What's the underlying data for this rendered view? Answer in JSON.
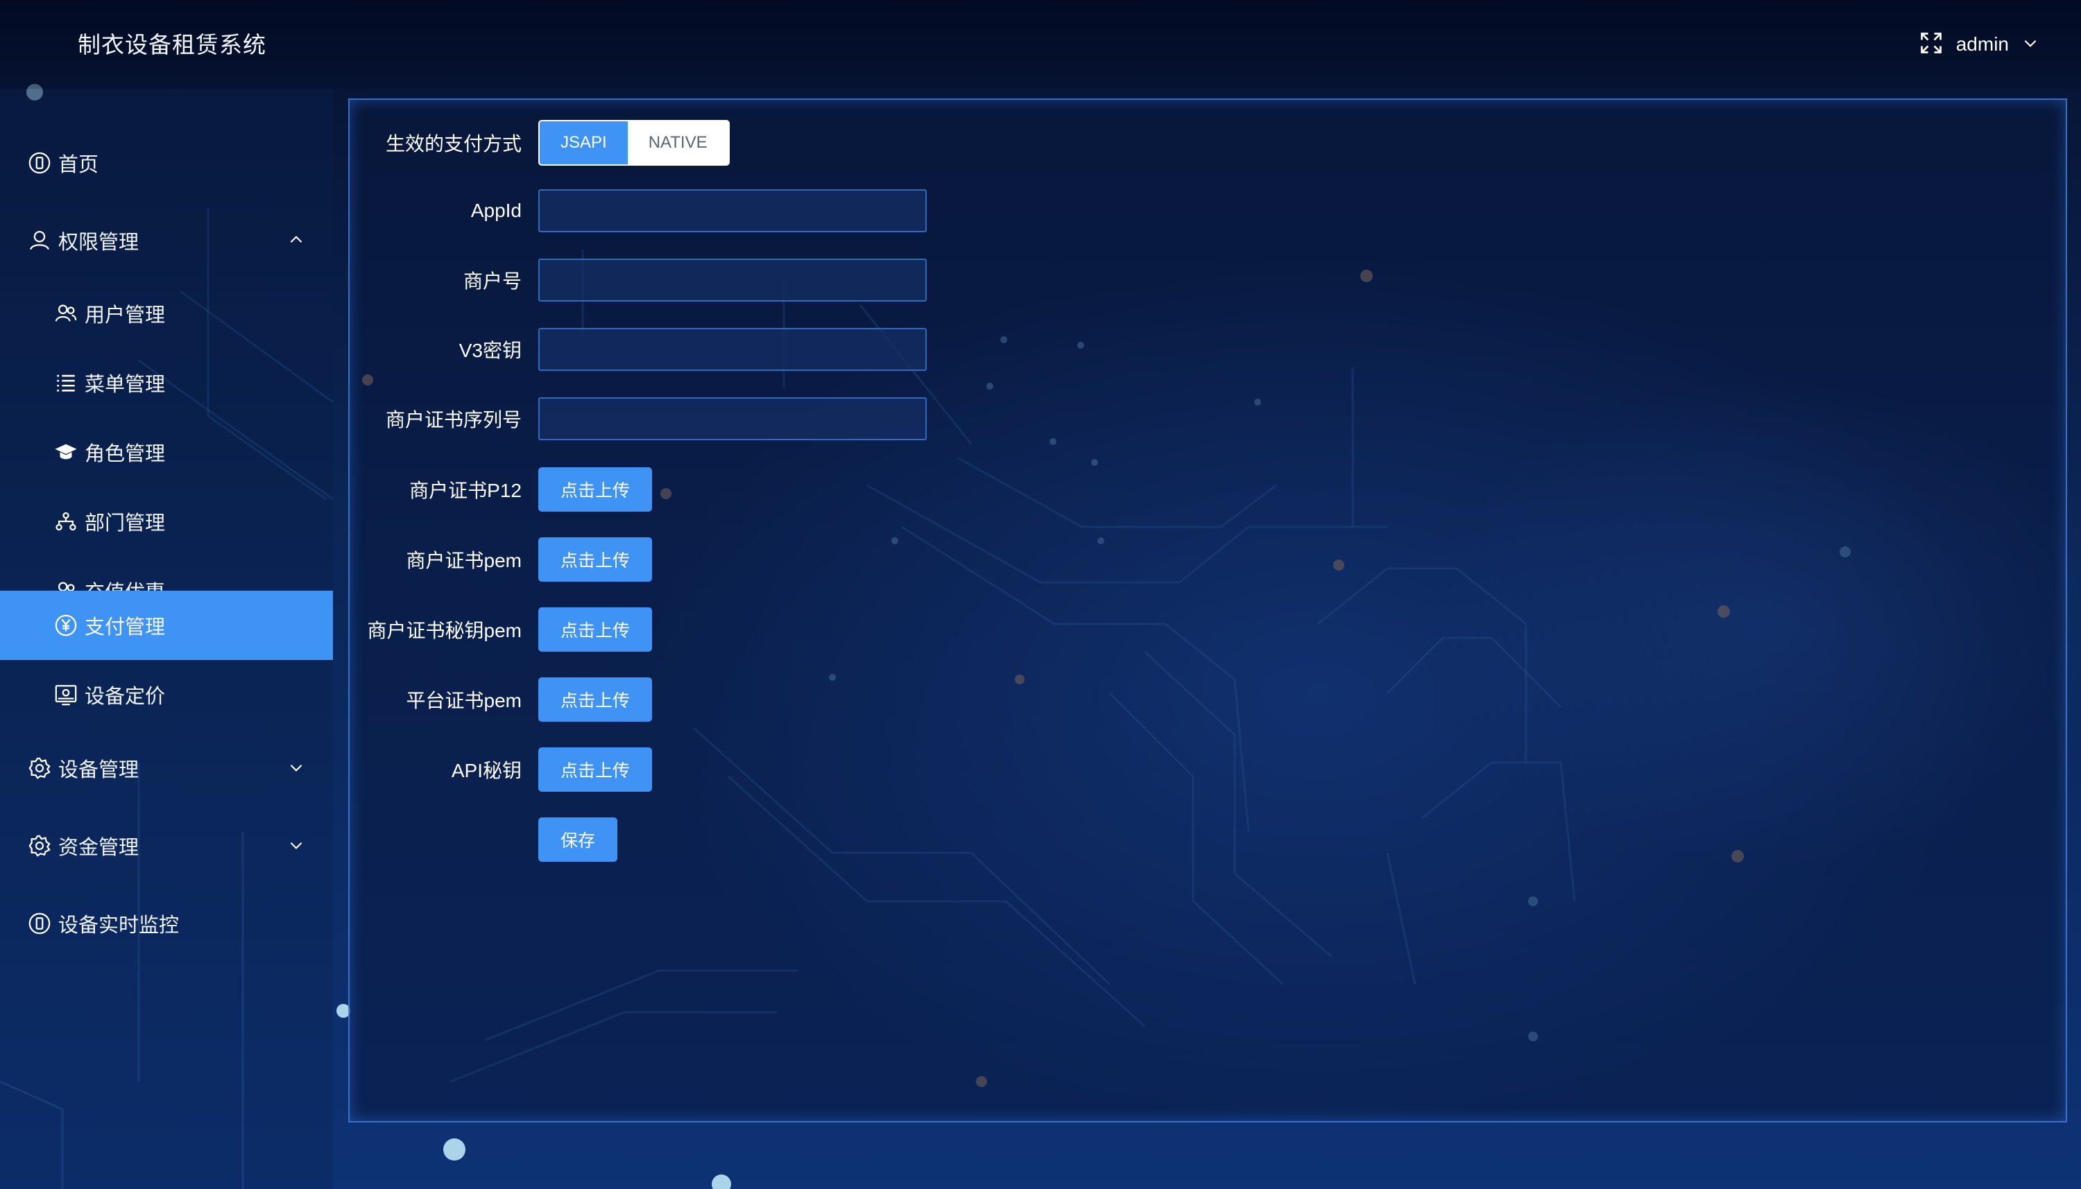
{
  "app": {
    "title": "制衣设备租赁系统"
  },
  "header": {
    "user_name": "admin",
    "fullscreen_icon": "fullscreen-icon",
    "dropdown_icon": "chevron-down-icon"
  },
  "sidebar": {
    "items": [
      {
        "label": "首页",
        "icon": "phone-icon",
        "level": 1
      },
      {
        "label": "权限管理",
        "icon": "user-icon",
        "level": 1,
        "expanded": true
      },
      {
        "label": "用户管理",
        "icon": "users-icon",
        "level": 2
      },
      {
        "label": "菜单管理",
        "icon": "list-icon",
        "level": 2
      },
      {
        "label": "角色管理",
        "icon": "graduation-cap-icon",
        "level": 2
      },
      {
        "label": "部门管理",
        "icon": "org-chart-icon",
        "level": 2
      },
      {
        "label": "充值优惠",
        "icon": "users-icon",
        "level": 2
      },
      {
        "label": "支付管理",
        "icon": "yen-icon",
        "level": 2,
        "active": true
      },
      {
        "label": "设备定价",
        "icon": "monitor-icon",
        "level": 2
      },
      {
        "label": "设备管理",
        "icon": "gear-icon",
        "level": 1,
        "expanded": false
      },
      {
        "label": "资金管理",
        "icon": "gear-icon",
        "level": 1,
        "expanded": false
      },
      {
        "label": "设备实时监控",
        "icon": "phone-icon",
        "level": 1
      }
    ]
  },
  "colors": {
    "accent": "#3f93f5",
    "panel_border": "#4a8ceb"
  },
  "form": {
    "pay_mode": {
      "label": "生效的支付方式",
      "options": [
        "JSAPI",
        "NATIVE"
      ],
      "selected": "JSAPI"
    },
    "appid": {
      "label": "AppId",
      "value": ""
    },
    "merchant_id": {
      "label": "商户号",
      "value": ""
    },
    "v3_key": {
      "label": "V3密钥",
      "value": ""
    },
    "cert_serial": {
      "label": "商户证书序列号",
      "value": ""
    },
    "cert_p12": {
      "label": "商户证书P12",
      "button": "点击上传"
    },
    "cert_pem": {
      "label": "商户证书pem",
      "button": "点击上传"
    },
    "cert_key_pem": {
      "label": "商户证书秘钥pem",
      "button": "点击上传"
    },
    "platform_cert_pem": {
      "label": "平台证书pem",
      "button": "点击上传"
    },
    "api_key": {
      "label": "API秘钥",
      "button": "点击上传"
    },
    "save_label": "保存"
  }
}
